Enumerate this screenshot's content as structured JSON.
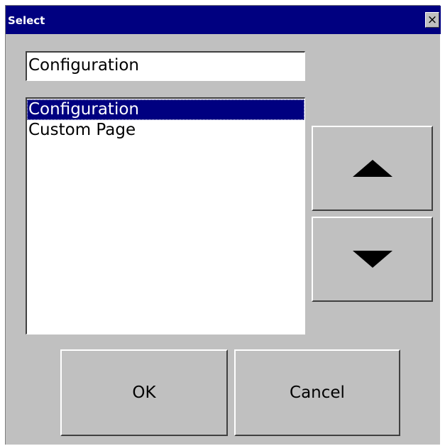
{
  "window": {
    "title": "Select",
    "close_glyph": "×"
  },
  "name_field": {
    "value": "Configuration"
  },
  "list": {
    "items": [
      {
        "label": "Configuration",
        "selected": true
      },
      {
        "label": "Custom Page",
        "selected": false
      }
    ]
  },
  "buttons": {
    "up_icon": "arrow-up-icon",
    "down_icon": "arrow-down-icon",
    "ok_label": "OK",
    "cancel_label": "Cancel"
  },
  "colors": {
    "titlebar": "#000080",
    "dialog_bg": "#c0c0c0",
    "selection": "#000080"
  }
}
